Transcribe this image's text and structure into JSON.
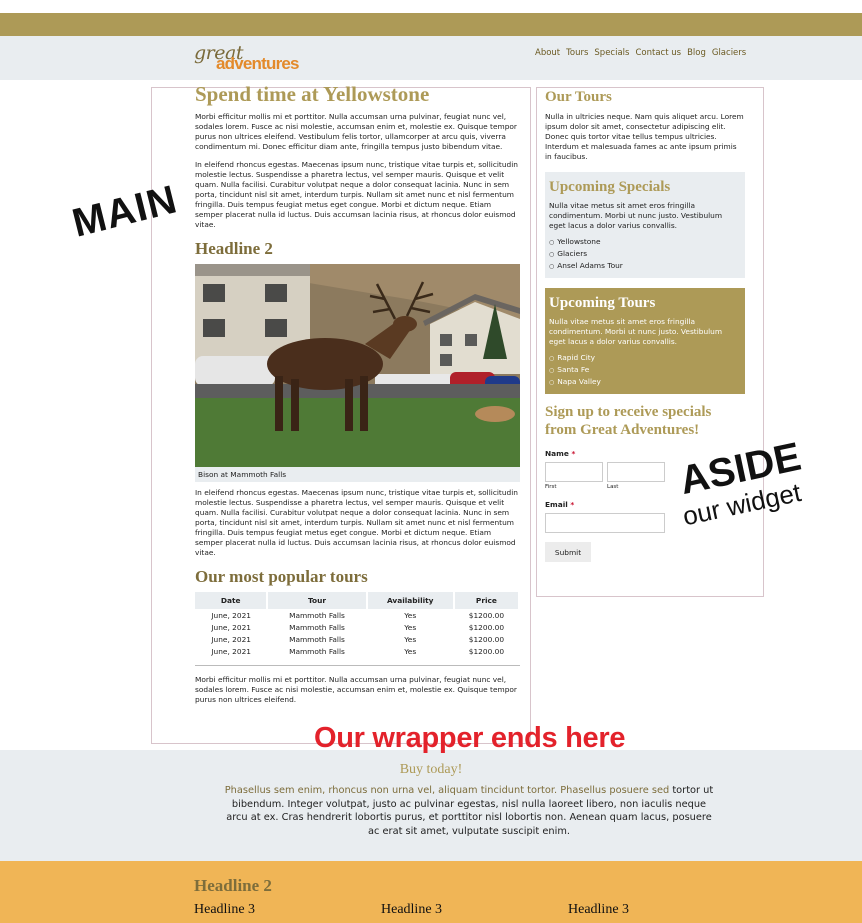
{
  "logo": {
    "line1": "great",
    "line2": "adventures"
  },
  "nav": [
    "About",
    "Tours",
    "Specials",
    "Contact us",
    "Blog",
    "Glaciers"
  ],
  "main": {
    "title": "Spend time at Yellowstone",
    "para1": "Morbi efficitur mollis mi et porttitor. Nulla accumsan urna pulvinar, feugiat nunc vel, sodales lorem. Fusce ac nisi molestie, accumsan enim et, molestie ex. Quisque tempor purus non ultrices eleifend. Vestibulum felis tortor, ullamcorper at arcu quis, viverra condimentum mi. Donec efficitur diam ante, fringilla tempus justo bibendum vitae.",
    "para2": "In eleifend rhoncus egestas. Maecenas ipsum nunc, tristique vitae turpis et, sollicitudin molestie lectus. Suspendisse a pharetra lectus, vel semper mauris. Quisque et velit quam. Nulla facilisi. Curabitur volutpat neque a dolor consequat lacinia. Nunc in sem porta, tincidunt nisl sit amet, interdum turpis. Nullam sit amet nunc et nisl fermentum fringilla. Duis tempus feugiat metus eget congue. Morbi et dictum neque. Etiam semper placerat nulla id luctus. Duis accumsan lacinia risus, at rhoncus dolor euismod vitae.",
    "headline2": "Headline 2",
    "caption": "Bison at Mammoth Falls",
    "para3": "In eleifend rhoncus egestas. Maecenas ipsum nunc, tristique vitae turpis et, sollicitudin molestie lectus. Suspendisse a pharetra lectus, vel semper mauris. Quisque et velit quam. Nulla facilisi. Curabitur volutpat neque a dolor consequat lacinia. Nunc in sem porta, tincidunt nisl sit amet, interdum turpis. Nullam sit amet nunc et nisl fermentum fringilla. Duis tempus feugiat metus eget congue. Morbi et dictum neque. Etiam semper placerat nulla id luctus. Duis accumsan lacinia risus, at rhoncus dolor euismod vitae.",
    "popular_title": "Our most popular tours",
    "table": {
      "headers": [
        "Date",
        "Tour",
        "Availability",
        "Price"
      ],
      "rows": [
        [
          "June, 2021",
          "Mammoth Falls",
          "Yes",
          "$1200.00"
        ],
        [
          "June, 2021",
          "Mammoth Falls",
          "Yes",
          "$1200.00"
        ],
        [
          "June, 2021",
          "Mammoth Falls",
          "Yes",
          "$1200.00"
        ],
        [
          "June, 2021",
          "Mammoth Falls",
          "Yes",
          "$1200.00"
        ]
      ]
    },
    "para4": "Morbi efficitur mollis mi et porttitor. Nulla accumsan urna pulvinar, feugiat nunc vel, sodales lorem. Fusce ac nisi molestie, accumsan enim et, molestie ex. Quisque tempor purus non ultrices eleifend."
  },
  "aside": {
    "tours_title": "Our Tours",
    "tours_text": "Nulla in ultricies neque. Nam quis aliquet arcu. Lorem ipsum dolor sit amet, consectetur adipiscing elit. Donec quis tortor vitae tellus tempus ultricies. Interdum et malesuada fames ac ante ipsum primis in faucibus.",
    "specials_title": "Upcoming Specials",
    "specials_text": "Nulla vitae metus sit amet eros fringilla condimentum. Morbi ut nunc justo. Vestibulum eget lacus a dolor varius convallis.",
    "specials_items": [
      "Yellowstone",
      "Glaciers",
      "Ansel Adams Tour"
    ],
    "upcoming_title": "Upcoming Tours",
    "upcoming_text": "Nulla vitae metus sit amet eros fringilla condimentum. Morbi ut nunc justo. Vestibulum eget lacus a dolor varius convallis.",
    "upcoming_items": [
      "Rapid City",
      "Santa Fe",
      "Napa Valley"
    ],
    "signup_title": "Sign up to receive specials from Great Adventures!",
    "name_label": "Name",
    "required_mark": "*",
    "first_label": "First",
    "last_label": "Last",
    "email_label": "Email",
    "submit_label": "Submit"
  },
  "annotations": {
    "main": "MAIN",
    "aside": "ASIDE",
    "widget": "our widget",
    "wrapper": "Our wrapper ends here"
  },
  "footer": {
    "buy": "Buy today!",
    "text_gold": "Phasellus sem enim, rhoncus non urna vel, aliquam tincidunt tortor. Phasellus posuere sed",
    "text": "tortor ut bibendum. Integer volutpat, justo ac pulvinar egestas, nisl nulla laoreet libero, non iaculis neque arcu at ex. Cras hendrerit lobortis purus, et porttitor nisl lobortis non. Aenean quam lacus, posuere ac erat sit amet, vulputate suscipit enim."
  },
  "bottom": {
    "headline2": "Headline 2",
    "headline3": [
      "Headline 3",
      "Headline 3",
      "Headline 3"
    ]
  },
  "colors": {
    "gold": "#ad9a57",
    "orange": "#e38a2b",
    "band": "#e9edf0",
    "bottom": "#f0b556",
    "annot_red": "#e3222b"
  }
}
